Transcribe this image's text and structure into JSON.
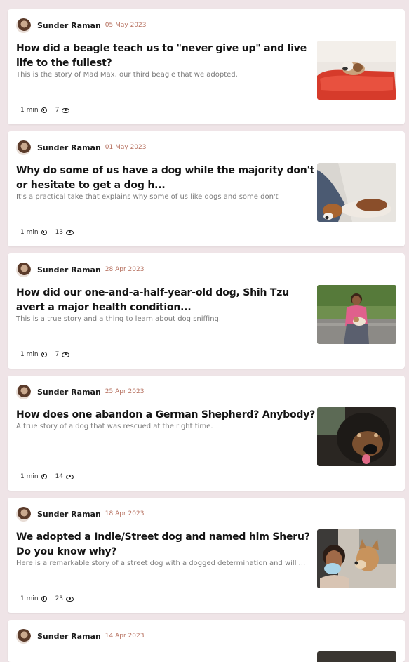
{
  "posts": [
    {
      "author": "Sunder Raman",
      "date": "05 May 2023",
      "title": "How did a beagle teach us to \"never give up\" and live life to the fullest?",
      "excerpt": "This is the story of Mad Max, our third beagle that we adopted.",
      "read_time": "1 min",
      "views": "7",
      "image": "beagle-on-red-bed"
    },
    {
      "author": "Sunder Raman",
      "date": "01 May 2023",
      "title": "Why do some of us have a dog while the majority don't or hesitate to get a dog h...",
      "excerpt": "It's a practical take that explains why some of us like dogs and some don't",
      "read_time": "1 min",
      "views": "13",
      "image": "beagle-on-floor"
    },
    {
      "author": "Sunder Raman",
      "date": "28 Apr 2023",
      "title": "How did our one-and-a-half-year-old dog, Shih Tzu avert a major health condition...",
      "excerpt": "This is a true story and a thing to learn about dog sniffing.",
      "read_time": "1 min",
      "views": "7",
      "image": "woman-with-shih-tzu"
    },
    {
      "author": "Sunder Raman",
      "date": "25 Apr 2023",
      "title": "How does one abandon a German Shepherd? Anybody?",
      "excerpt": "A true story of a dog that was rescued at the right time.",
      "read_time": "1 min",
      "views": "14",
      "image": "german-shepherd-in-car"
    },
    {
      "author": "Sunder Raman",
      "date": "18 Apr 2023",
      "title": "We adopted a Indie/Street dog and named him Sheru? Do you know why?",
      "excerpt": "Here is a remarkable story of a street dog with a dogged determination and will ...",
      "read_time": "1 min",
      "views": "23",
      "image": "woman-with-street-dog"
    },
    {
      "author": "Sunder Raman",
      "date": "14 Apr 2023"
    }
  ],
  "colors": {
    "background": "#efe4e7",
    "date": "#b6705f",
    "card": "#ffffff"
  },
  "icons": {
    "read_time": "clock-icon",
    "views": "eye-icon"
  }
}
